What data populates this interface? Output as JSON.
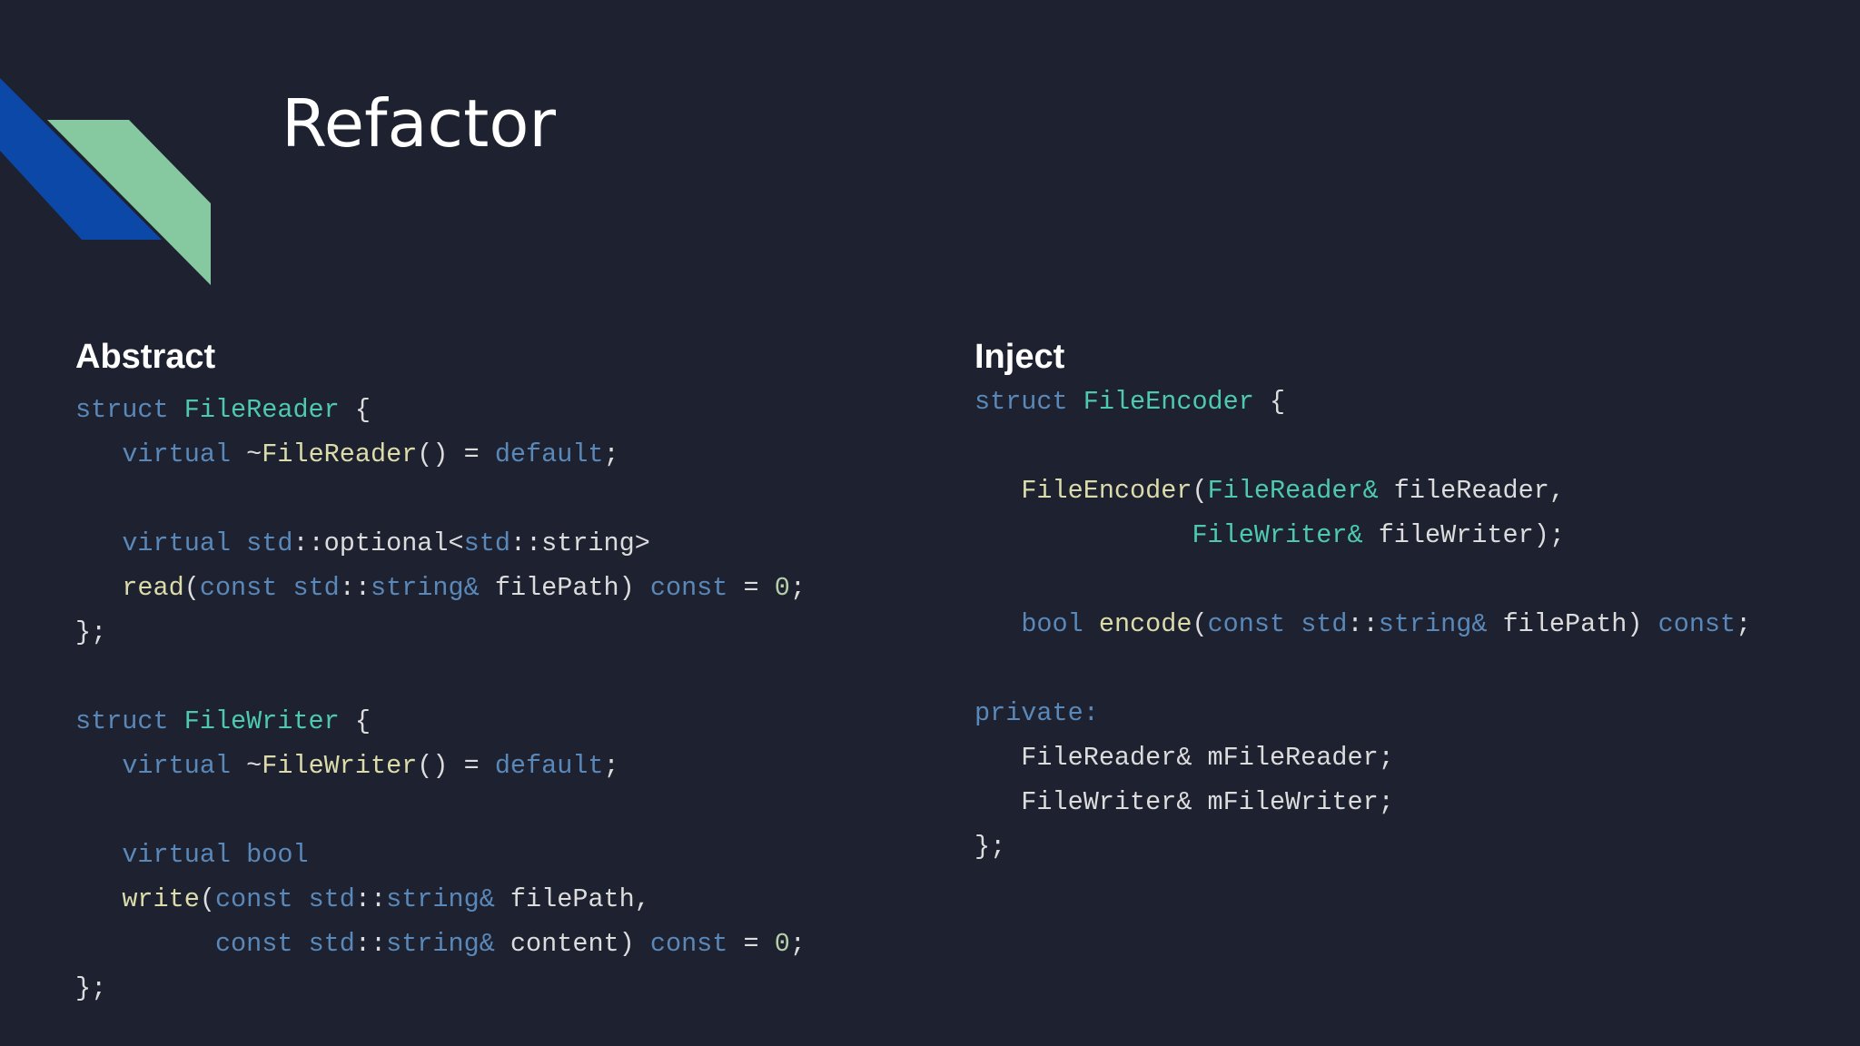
{
  "slide": {
    "title": "Refactor"
  },
  "left": {
    "heading": "Abstract",
    "code_lines": [
      [
        [
          "kw",
          "struct "
        ],
        [
          "ty",
          "FileReader"
        ],
        [
          "tx",
          " {"
        ]
      ],
      [
        [
          "tx",
          "   "
        ],
        [
          "kw",
          "virtual"
        ],
        [
          "tx",
          " ~"
        ],
        [
          "fn",
          "FileReader"
        ],
        [
          "tx",
          "() = "
        ],
        [
          "kw",
          "default"
        ],
        [
          "tx",
          ";"
        ]
      ],
      [],
      [
        [
          "tx",
          "   "
        ],
        [
          "kw",
          "virtual"
        ],
        [
          "tx",
          " "
        ],
        [
          "kw",
          "std"
        ],
        [
          "tx",
          "::optional<"
        ],
        [
          "kw",
          "std"
        ],
        [
          "tx",
          "::string>"
        ]
      ],
      [
        [
          "tx",
          "   "
        ],
        [
          "fn",
          "read"
        ],
        [
          "tx",
          "("
        ],
        [
          "kw",
          "const"
        ],
        [
          "tx",
          " "
        ],
        [
          "kw",
          "std"
        ],
        [
          "tx",
          "::"
        ],
        [
          "kw",
          "string&"
        ],
        [
          "tx",
          " filePath) "
        ],
        [
          "kw",
          "const"
        ],
        [
          "tx",
          " = "
        ],
        [
          "num",
          "0"
        ],
        [
          "tx",
          ";"
        ]
      ],
      [
        [
          "tx",
          "};"
        ]
      ],
      [],
      [
        [
          "kw",
          "struct "
        ],
        [
          "ty",
          "FileWriter"
        ],
        [
          "tx",
          " {"
        ]
      ],
      [
        [
          "tx",
          "   "
        ],
        [
          "kw",
          "virtual"
        ],
        [
          "tx",
          " ~"
        ],
        [
          "fn",
          "FileWriter"
        ],
        [
          "tx",
          "() = "
        ],
        [
          "kw",
          "default"
        ],
        [
          "tx",
          ";"
        ]
      ],
      [],
      [
        [
          "tx",
          "   "
        ],
        [
          "kw",
          "virtual"
        ],
        [
          "tx",
          " "
        ],
        [
          "kw",
          "bool"
        ]
      ],
      [
        [
          "tx",
          "   "
        ],
        [
          "fn",
          "write"
        ],
        [
          "tx",
          "("
        ],
        [
          "kw",
          "const"
        ],
        [
          "tx",
          " "
        ],
        [
          "kw",
          "std"
        ],
        [
          "tx",
          "::"
        ],
        [
          "kw",
          "string&"
        ],
        [
          "tx",
          " filePath,"
        ]
      ],
      [
        [
          "tx",
          "         "
        ],
        [
          "kw",
          "const"
        ],
        [
          "tx",
          " "
        ],
        [
          "kw",
          "std"
        ],
        [
          "tx",
          "::"
        ],
        [
          "kw",
          "string&"
        ],
        [
          "tx",
          " content) "
        ],
        [
          "kw",
          "const"
        ],
        [
          "tx",
          " = "
        ],
        [
          "num",
          "0"
        ],
        [
          "tx",
          ";"
        ]
      ],
      [
        [
          "tx",
          "};"
        ]
      ]
    ]
  },
  "right": {
    "heading": "Inject",
    "code_lines": [
      [
        [
          "kw",
          "struct "
        ],
        [
          "ty",
          "FileEncoder"
        ],
        [
          "tx",
          " {"
        ]
      ],
      [],
      [
        [
          "tx",
          "   "
        ],
        [
          "fn",
          "FileEncoder"
        ],
        [
          "tx",
          "("
        ],
        [
          "ty",
          "FileReader&"
        ],
        [
          "tx",
          " fileReader,"
        ]
      ],
      [
        [
          "tx",
          "              "
        ],
        [
          "ty",
          "FileWriter&"
        ],
        [
          "tx",
          " fileWriter);"
        ]
      ],
      [],
      [
        [
          "tx",
          "   "
        ],
        [
          "kw",
          "bool"
        ],
        [
          "tx",
          " "
        ],
        [
          "fn",
          "encode"
        ],
        [
          "tx",
          "("
        ],
        [
          "kw",
          "const"
        ],
        [
          "tx",
          " "
        ],
        [
          "kw",
          "std"
        ],
        [
          "tx",
          "::"
        ],
        [
          "kw",
          "string&"
        ],
        [
          "tx",
          " filePath) "
        ],
        [
          "kw",
          "const"
        ],
        [
          "tx",
          ";"
        ]
      ],
      [],
      [
        [
          "kw",
          "private:"
        ]
      ],
      [
        [
          "tx",
          "   FileReader& mFileReader;"
        ]
      ],
      [
        [
          "tx",
          "   FileWriter& mFileWriter;"
        ]
      ],
      [
        [
          "tx",
          "};"
        ]
      ]
    ]
  },
  "colors": {
    "background": "#1d2130",
    "accent_blue": "#0b48a8",
    "accent_green": "#86c9a0",
    "keyword": "#5a88b8",
    "type": "#4ec9b0",
    "function": "#dcdcaa",
    "text": "#dcdcdc",
    "number": "#b5cea8"
  }
}
